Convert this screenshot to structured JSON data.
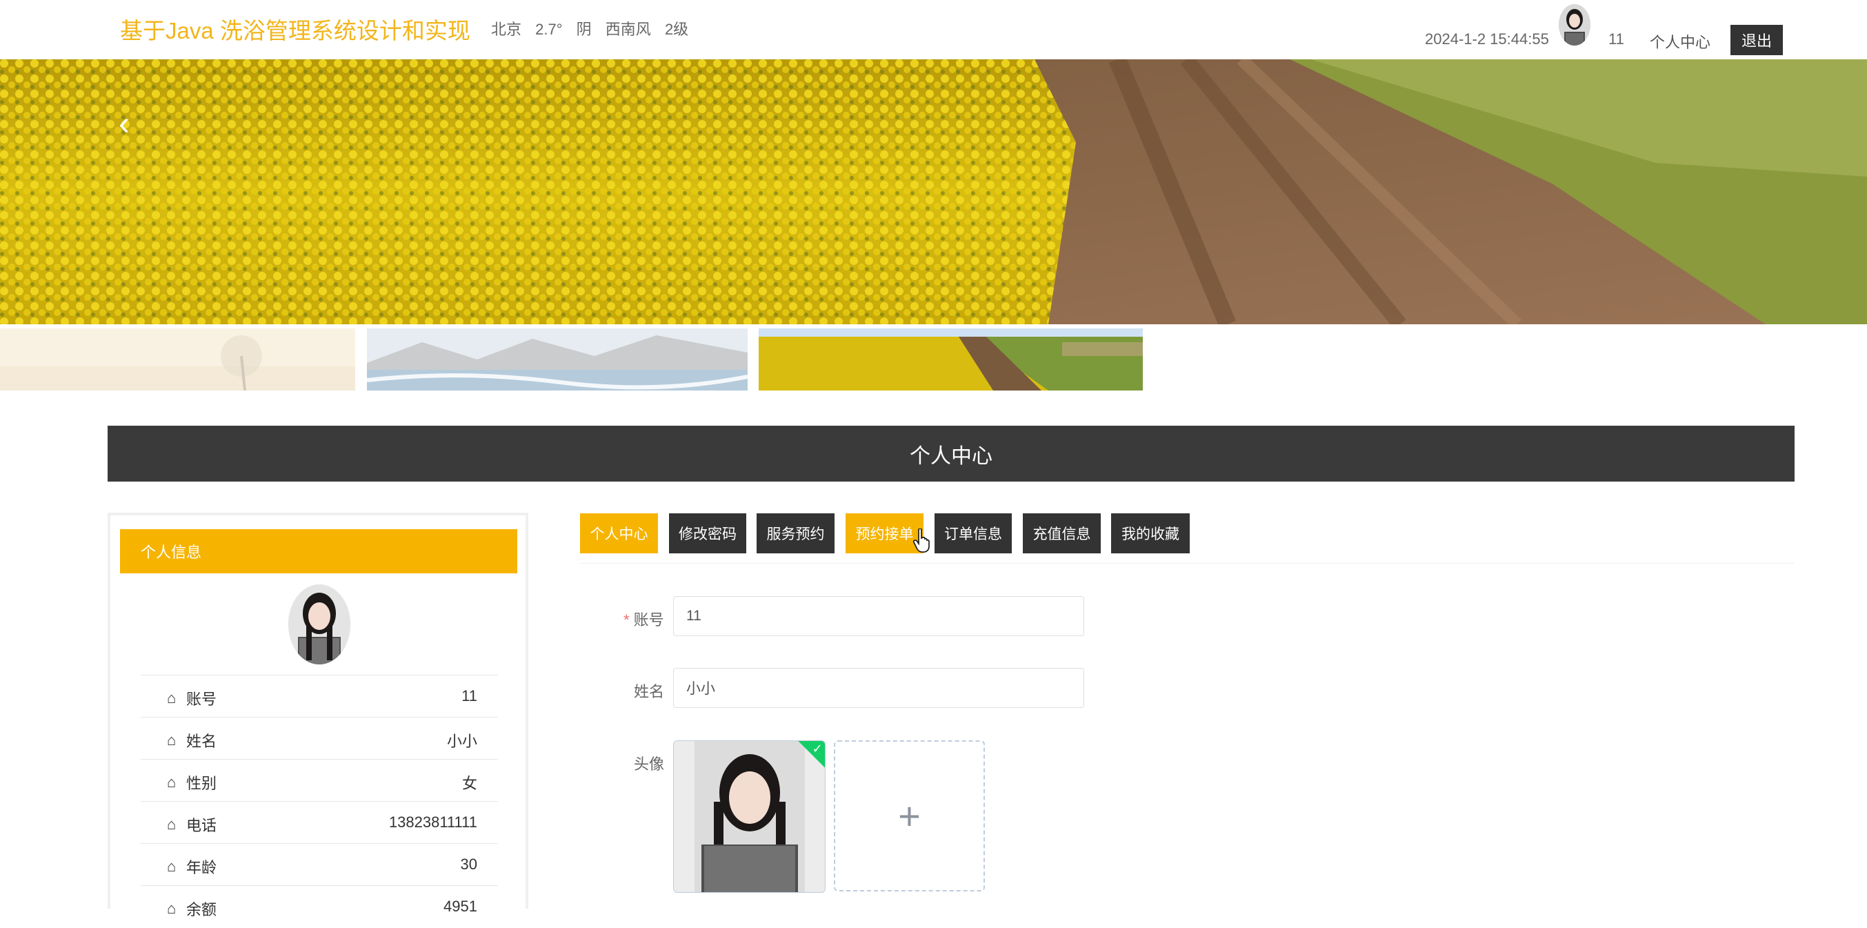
{
  "header": {
    "site_title": "基于Java 洗浴管理系统设计和实现",
    "weather": {
      "city": "北京",
      "temp": "2.7°",
      "condition": "阴",
      "wind": "西南风",
      "level": "2级"
    },
    "datetime": "2024-1-2 15:44:55",
    "username": "11",
    "center_link": "个人中心",
    "logout": "退出"
  },
  "banner": {
    "prev_icon": "‹"
  },
  "page_title": "个人中心",
  "profile_card": {
    "heading": "个人信息",
    "rows": [
      {
        "icon": "⌂",
        "label": "账号",
        "value": "11"
      },
      {
        "icon": "⌂",
        "label": "姓名",
        "value": "小小"
      },
      {
        "icon": "⌂",
        "label": "性别",
        "value": "女"
      },
      {
        "icon": "⌂",
        "label": "电话",
        "value": "13823811111"
      },
      {
        "icon": "⌂",
        "label": "年龄",
        "value": "30"
      },
      {
        "icon": "⌂",
        "label": "余额",
        "value": "4951"
      }
    ]
  },
  "tabs": [
    {
      "label": "个人中心",
      "active": true
    },
    {
      "label": "修改密码",
      "active": false
    },
    {
      "label": "服务预约",
      "active": false
    },
    {
      "label": "预约接单",
      "active": true
    },
    {
      "label": "订单信息",
      "active": false
    },
    {
      "label": "充值信息",
      "active": false
    },
    {
      "label": "我的收藏",
      "active": false
    }
  ],
  "form": {
    "account": {
      "label": "账号",
      "required_mark": "*",
      "value": "11"
    },
    "name": {
      "label": "姓名",
      "value": "小小"
    },
    "avatar": {
      "label": "头像",
      "check_icon": "✓",
      "add_icon": "+"
    }
  },
  "colors": {
    "accent": "#f6b400",
    "title": "#f2b51b",
    "dark": "#333333",
    "success": "#13ce66"
  }
}
